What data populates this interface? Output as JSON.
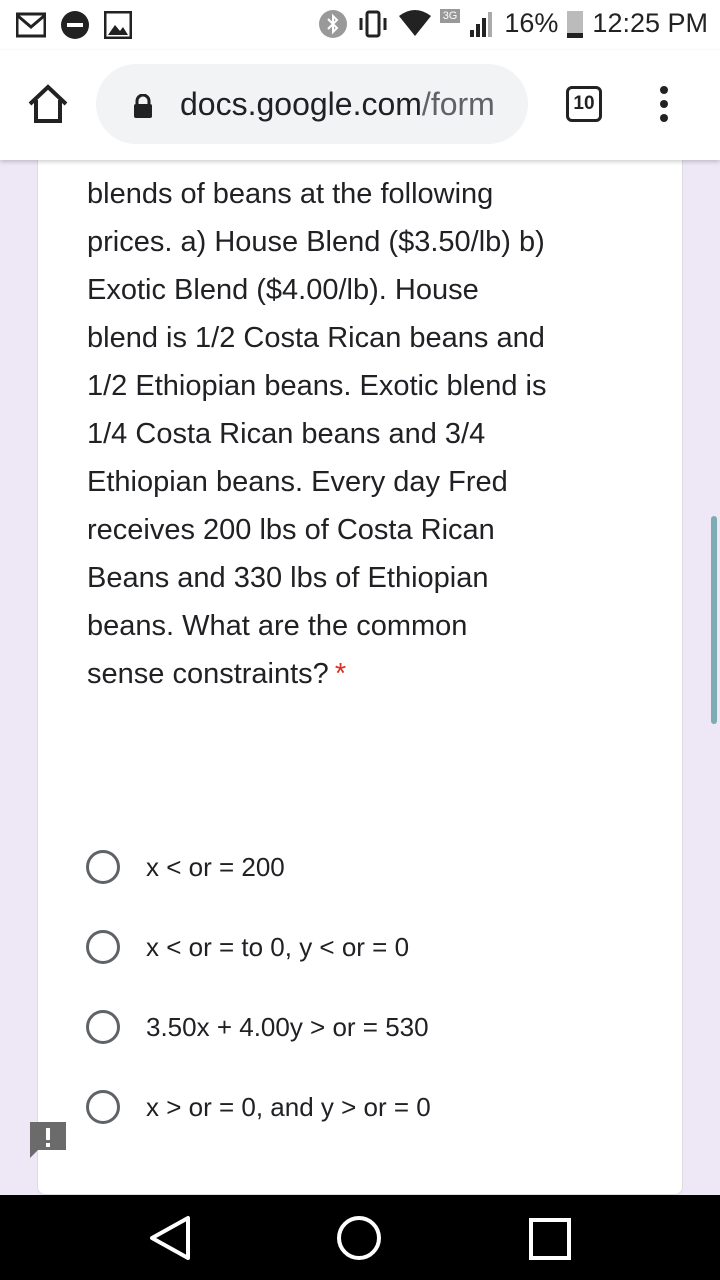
{
  "status": {
    "battery_text": "16%",
    "time": "12:25 PM",
    "network": "3G"
  },
  "browser": {
    "url_domain": "docs.google.com",
    "url_path": "/form",
    "tab_count": "10"
  },
  "question": {
    "text": "blends of beans at the following prices. a) House Blend ($3.50/lb) b) Exotic Blend ($4.00/lb). House blend is 1/2 Costa Rican beans and 1/2 Ethiopian beans. Exotic blend is 1/4 Costa Rican beans and 3/4 Ethiopian beans. Every day Fred receives 200 lbs of Costa Rican Beans and 330 lbs of Ethiopian beans. What are the common sense constraints?",
    "required_mark": "*"
  },
  "options": [
    {
      "label": "x < or = 200"
    },
    {
      "label": "x < or = to 0, y < or = 0"
    },
    {
      "label": "3.50x + 4.00y > or = 530"
    },
    {
      "label": "x > or = 0, and y > or = 0"
    }
  ],
  "icons": {
    "gmail": "gmail-icon",
    "dnd": "do-not-disturb-icon",
    "gallery": "image-icon",
    "bluetooth": "bluetooth-icon",
    "vibrate": "vibrate-icon",
    "wifi": "wifi-icon",
    "signal": "signal-icon",
    "battery": "battery-icon",
    "home": "home-icon",
    "lock": "lock-icon",
    "menu": "more-vert-icon",
    "feedback": "feedback-icon",
    "back": "back-icon",
    "home_nav": "home-circle-icon",
    "recents": "recents-icon"
  },
  "colors": {
    "page_bg": "#ede7f6",
    "required": "#d93025",
    "scrollbar": "#5f9ea0"
  }
}
